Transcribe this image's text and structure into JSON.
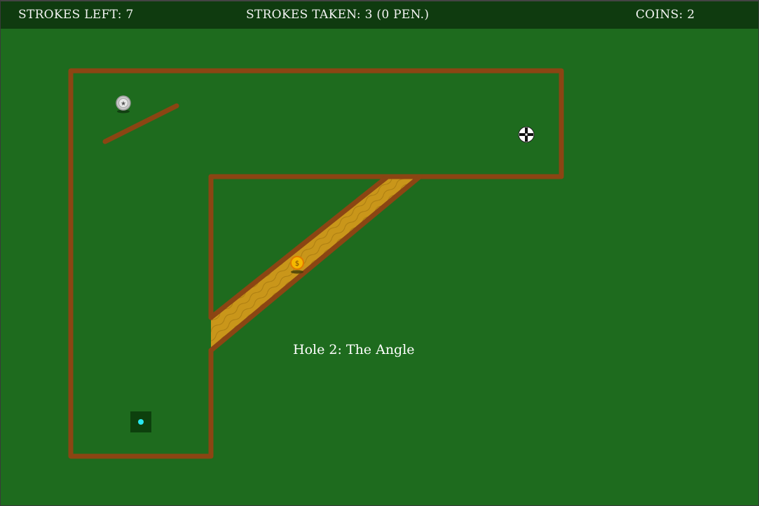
{
  "hud": {
    "strokes_left": "STROKES LEFT: 7",
    "strokes_taken": "STROKES TAKEN: 3 (0 PEN.)",
    "coins": "COINS: 2"
  },
  "course": {
    "hole_title": "Hole 2: The Angle",
    "coin_symbol": "$",
    "ball_icon": "star-ball-icon",
    "cursor_icon": "crosshair-cursor-icon",
    "colors": {
      "grass": "#1e6b1e",
      "hud": "#0f3b0f",
      "wall": "#8b4513",
      "sand": "#c9961a",
      "coin": "#f5b800",
      "cup": "#0d400d",
      "target": "#29e6f0"
    }
  }
}
